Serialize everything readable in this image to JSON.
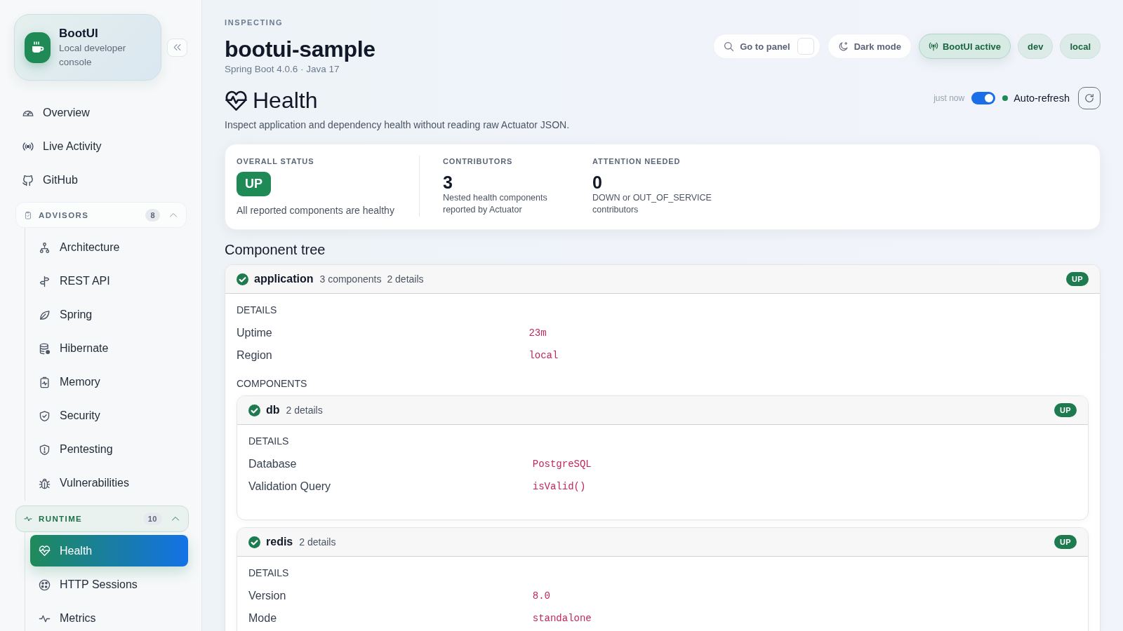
{
  "sidebar": {
    "brand": {
      "title": "BootUI",
      "subtitle": "Local developer console"
    },
    "nav": [
      {
        "label": "Overview",
        "selected": false
      },
      {
        "label": "Live Activity",
        "selected": false
      },
      {
        "label": "GitHub",
        "selected": false
      }
    ],
    "groups": [
      {
        "label": "ADVISORS",
        "count": "8",
        "expanded": true,
        "items": [
          {
            "label": "Architecture",
            "selected": false
          },
          {
            "label": "REST API",
            "selected": false
          },
          {
            "label": "Spring",
            "selected": false
          },
          {
            "label": "Hibernate",
            "selected": false
          },
          {
            "label": "Memory",
            "selected": false
          },
          {
            "label": "Security",
            "selected": false
          },
          {
            "label": "Pentesting",
            "selected": false
          },
          {
            "label": "Vulnerabilities",
            "selected": false
          }
        ]
      },
      {
        "label": "RUNTIME",
        "count": "10",
        "expanded": true,
        "items": [
          {
            "label": "Health",
            "selected": true
          },
          {
            "label": "HTTP Sessions",
            "selected": false
          },
          {
            "label": "Metrics",
            "selected": false
          }
        ]
      }
    ]
  },
  "header": {
    "eyebrow": "INSPECTING",
    "app_name": "bootui-sample",
    "meta": "Spring Boot 4.0.6 · Java 17",
    "actions": [
      {
        "label": "Go to panel",
        "kind": "search"
      },
      {
        "label": "Dark mode",
        "kind": "theme"
      }
    ],
    "chips": [
      {
        "label": "BootUI active",
        "kind": "status"
      },
      {
        "label": "dev",
        "kind": "env"
      },
      {
        "label": "local",
        "kind": "env"
      }
    ]
  },
  "page": {
    "title": "Health",
    "description": "Inspect application and dependency health without reading raw Actuator JSON.",
    "updated": "just now",
    "auto_refresh": {
      "label": "Auto-refresh",
      "on": true
    }
  },
  "summary": [
    {
      "label": "OVERALL STATUS",
      "kind": "badge",
      "value": "UP",
      "healthy": true,
      "note": "All reported components are healthy"
    },
    {
      "label": "CONTRIBUTORS",
      "kind": "number",
      "value": "3",
      "note": "Nested health components reported by Actuator"
    },
    {
      "label": "ATTENTION NEEDED",
      "kind": "number",
      "value": "0",
      "note": "DOWN or OUT_OF_SERVICE contributors"
    }
  ],
  "component_tree": {
    "title": "Component tree",
    "root": {
      "name": "application",
      "summary": [
        "3 components",
        "2 details"
      ],
      "status": "UP",
      "healthy": true,
      "details_label": "DETAILS",
      "details": [
        {
          "key": "Uptime",
          "value": "23m"
        },
        {
          "key": "Region",
          "value": "local"
        }
      ],
      "components_label": "COMPONENTS",
      "children": [
        {
          "name": "db",
          "summary": [
            "2 details"
          ],
          "status": "UP",
          "healthy": true,
          "details_label": "DETAILS",
          "details": [
            {
              "key": "Database",
              "value": "PostgreSQL"
            },
            {
              "key": "Validation Query",
              "value": "isValid()"
            }
          ]
        },
        {
          "name": "redis",
          "summary": [
            "2 details"
          ],
          "status": "UP",
          "healthy": true,
          "details_label": "DETAILS",
          "details": [
            {
              "key": "Version",
              "value": "8.0"
            },
            {
              "key": "Mode",
              "value": "standalone"
            }
          ]
        }
      ]
    }
  }
}
